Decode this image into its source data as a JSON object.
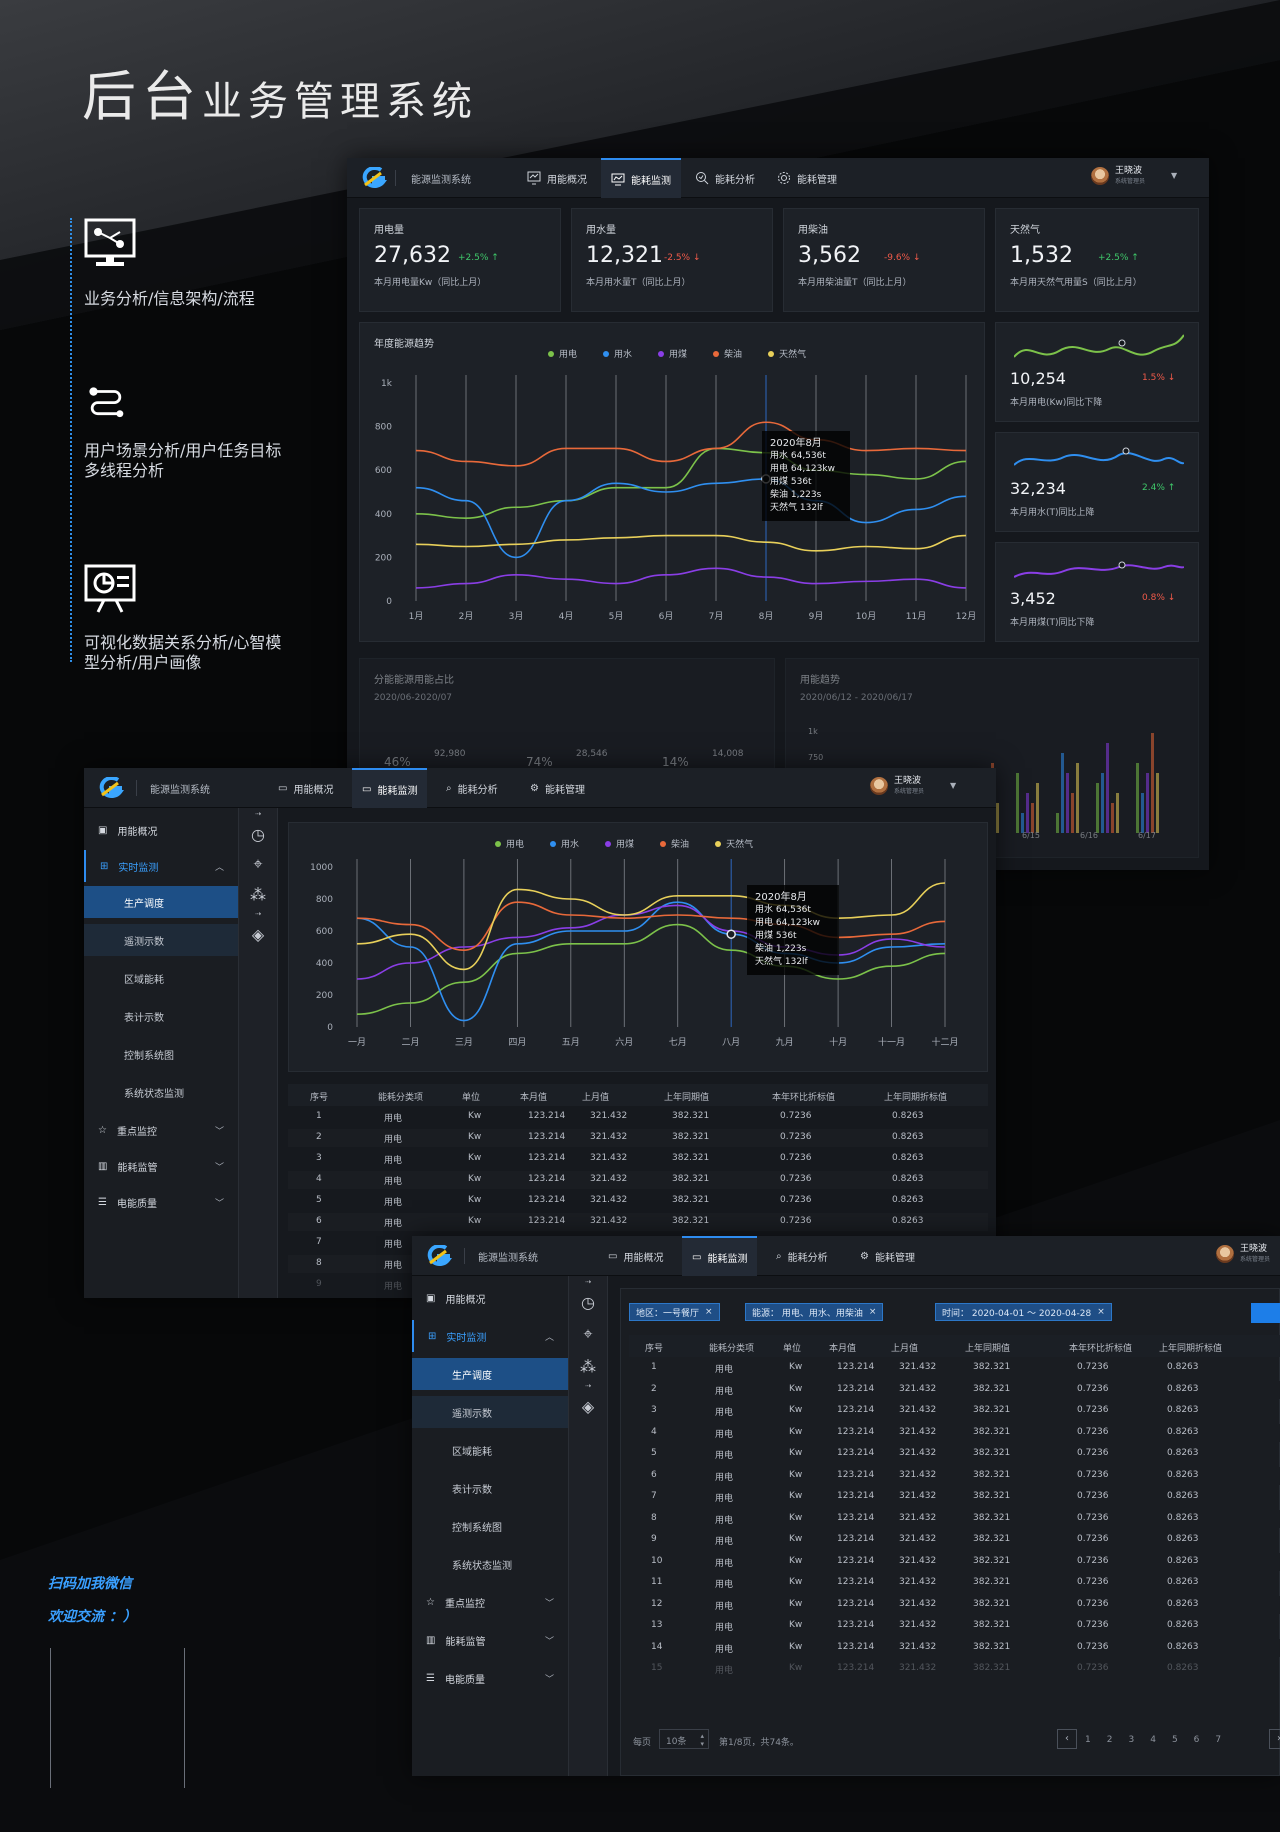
{
  "hero": {
    "title_big1": "后",
    "title_big2": "台",
    "title_rest": "业务管理系统"
  },
  "features": [
    {
      "icon": "monitor-flow-icon",
      "text": "业务分析/信息架构/流程"
    },
    {
      "icon": "route-icon",
      "text": "用户场景分析/用户任务目标多线程分析"
    },
    {
      "icon": "presentation-chart-icon",
      "text": "可视化数据关系分析/心智模型分析/用户画像"
    }
  ],
  "wechat": {
    "line1": "扫码加我微信",
    "line2": "欢迎交流 ：）"
  },
  "app": {
    "system_name": "能源监测系统",
    "nav": [
      "用能概况",
      "能耗监测",
      "能耗分析",
      "能耗管理"
    ],
    "active_nav": "能耗监测",
    "user_name": "王晓波",
    "user_role": "系统管理员"
  },
  "colors": {
    "electric": "#7cc24a",
    "water": "#2f8ff0",
    "coal": "#8a3ee6",
    "diesel": "#e8693a",
    "gas": "#e8d05a",
    "accent": "#2e8cf0"
  },
  "stats": [
    {
      "label": "用电量",
      "value": "27,632",
      "change": "+2.5%",
      "dir": "up",
      "sub": "本月用电量Kw（同比上月）"
    },
    {
      "label": "用水量",
      "value": "12,321",
      "change": "-2.5%",
      "dir": "down",
      "sub": "本月用水量T（同比上月）"
    },
    {
      "label": "用柴油",
      "value": "3,562",
      "change": "-9.6%",
      "dir": "down",
      "sub": "本月用柴油量T（同比上月）"
    },
    {
      "label": "天然气",
      "value": "1,532",
      "change": "+2.5%",
      "dir": "up",
      "sub": "本月用天然气用量S（同比上月）"
    }
  ],
  "mini_cards": [
    {
      "value": "10,254",
      "change": "1.5%",
      "dir": "down",
      "sub": "本月用电(Kw)同比下降"
    },
    {
      "value": "32,234",
      "change": "2.4%",
      "dir": "up",
      "sub": "本月用水(T)同比上降"
    },
    {
      "value": "3,452",
      "change": "0.8%",
      "dir": "down",
      "sub": "本月用煤(T)同比下降"
    }
  ],
  "trend_title": "年度能源趋势",
  "legend": [
    "用电",
    "用水",
    "用煤",
    "柴油",
    "天然气"
  ],
  "tooltip": {
    "title": "2020年8月",
    "lines": [
      "用水 64,536t",
      "用电 64,123kw",
      "用煤 536t",
      "柴油 1,223s",
      "天然气 132lf"
    ]
  },
  "share_card": {
    "title": "分能能源用能占比",
    "range": "2020/06-2020/07",
    "items": [
      {
        "pct": "46%",
        "val": "92,980"
      },
      {
        "pct": "74%",
        "val": "28,546"
      },
      {
        "pct": "14%",
        "val": "14,008"
      }
    ]
  },
  "usage_card": {
    "title": "用能趋势",
    "range": "2020/06/12 - 2020/06/17",
    "y_labels": [
      "1k",
      "750"
    ],
    "x_labels": [
      "6/15",
      "6/16",
      "6/17"
    ]
  },
  "sidebar": {
    "items": [
      "用能概况",
      "实时监测",
      "重点监控",
      "能耗监管",
      "电能质量"
    ],
    "subs": [
      "生产调度",
      "遥测示数",
      "区域能耗",
      "表计示数",
      "控制系统图",
      "系统状态监测"
    ]
  },
  "filters": {
    "region": "地区：一号餐厅",
    "source": "能源：  用电、用水、用柴油",
    "time": "时间：  2020-04-01 ～ 2020-04-28"
  },
  "table": {
    "headers": [
      "序号",
      "能耗分类项",
      "单位",
      "本月值",
      "上月值",
      "上年同期值",
      "本年环比折标值",
      "上年同期折标值"
    ],
    "row": {
      "cat": "用电",
      "unit": "Kw",
      "cur": "123.214",
      "prev": "321.432",
      "ly": "382.321",
      "ratio": "0.7236",
      "lyratio": "0.8263"
    }
  },
  "pagination": {
    "per_page": "每页",
    "size": "10条",
    "info": "第1/8页，共74条。",
    "pages": [
      "1",
      "2",
      "3",
      "4",
      "5",
      "6",
      "7"
    ]
  },
  "chart_data": [
    {
      "type": "line",
      "title": "年度能源趋势",
      "categories": [
        "1月",
        "2月",
        "3月",
        "4月",
        "5月",
        "6月",
        "7月",
        "8月",
        "9月",
        "10月",
        "11月",
        "12月"
      ],
      "y_ticks": [
        "0",
        "200",
        "400",
        "600",
        "800",
        "1k"
      ],
      "ylim": [
        0,
        1000
      ],
      "series": [
        {
          "name": "用电",
          "color": "#7cc24a",
          "values": [
            400,
            380,
            430,
            460,
            520,
            520,
            700,
            680,
            600,
            580,
            560,
            640
          ]
        },
        {
          "name": "用水",
          "color": "#2f8ff0",
          "values": [
            520,
            460,
            200,
            460,
            540,
            500,
            540,
            560,
            460,
            360,
            420,
            480
          ]
        },
        {
          "name": "用煤",
          "color": "#8a3ee6",
          "values": [
            60,
            80,
            120,
            100,
            80,
            120,
            150,
            110,
            80,
            90,
            100,
            60
          ]
        },
        {
          "name": "柴油",
          "color": "#e8693a",
          "values": [
            690,
            640,
            620,
            700,
            700,
            640,
            700,
            820,
            740,
            690,
            700,
            690
          ]
        },
        {
          "name": "天然气",
          "color": "#e8d05a",
          "values": [
            260,
            250,
            260,
            280,
            290,
            300,
            300,
            270,
            230,
            250,
            240,
            300
          ]
        }
      ]
    },
    {
      "type": "line",
      "categories": [
        "一月",
        "二月",
        "三月",
        "四月",
        "五月",
        "六月",
        "七月",
        "八月",
        "九月",
        "十月",
        "十一月",
        "十二月"
      ],
      "y_ticks": [
        "0",
        "200",
        "400",
        "600",
        "800",
        "1000"
      ],
      "ylim": [
        0,
        1000
      ],
      "series": [
        {
          "name": "用电",
          "color": "#7cc24a",
          "values": [
            80,
            150,
            280,
            460,
            520,
            520,
            640,
            480,
            380,
            300,
            380,
            460
          ]
        },
        {
          "name": "用水",
          "color": "#2f8ff0",
          "values": [
            680,
            500,
            40,
            520,
            600,
            600,
            780,
            580,
            460,
            400,
            500,
            520
          ]
        },
        {
          "name": "用煤",
          "color": "#8a3ee6",
          "values": [
            300,
            400,
            500,
            560,
            620,
            700,
            760,
            600,
            500,
            450,
            550,
            500
          ]
        },
        {
          "name": "柴油",
          "color": "#e8693a",
          "values": [
            680,
            640,
            480,
            780,
            700,
            680,
            700,
            680,
            640,
            560,
            580,
            660
          ]
        },
        {
          "name": "天然气",
          "color": "#e8d05a",
          "values": [
            520,
            580,
            360,
            860,
            800,
            700,
            820,
            820,
            760,
            680,
            700,
            900
          ]
        }
      ]
    }
  ]
}
